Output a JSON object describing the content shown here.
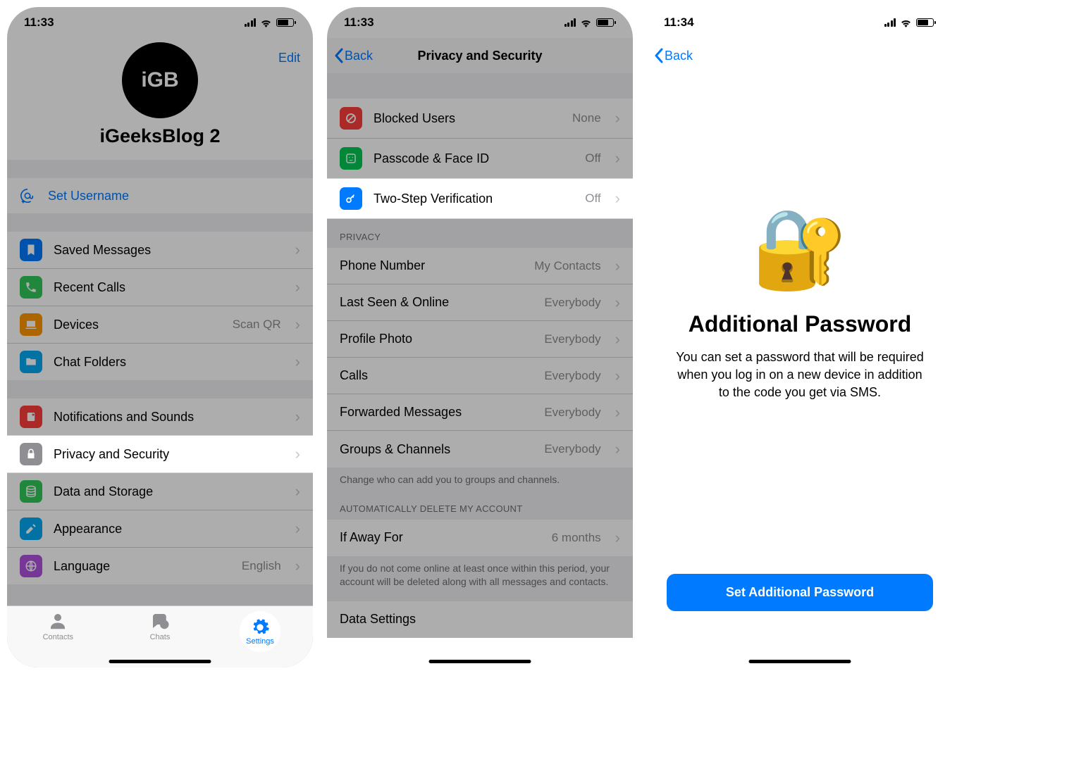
{
  "screen1": {
    "time": "11:33",
    "edit": "Edit",
    "avatar_label": "iGB",
    "profile_name": "iGeeksBlog 2",
    "set_username": "Set Username",
    "list_a": [
      {
        "label": "Saved Messages",
        "value": ""
      },
      {
        "label": "Recent Calls",
        "value": ""
      },
      {
        "label": "Devices",
        "value": "Scan QR"
      },
      {
        "label": "Chat Folders",
        "value": ""
      }
    ],
    "list_b": [
      {
        "label": "Notifications and Sounds",
        "value": ""
      },
      {
        "label": "Privacy and Security",
        "value": ""
      },
      {
        "label": "Data and Storage",
        "value": ""
      },
      {
        "label": "Appearance",
        "value": ""
      },
      {
        "label": "Language",
        "value": "English"
      }
    ],
    "tabs": {
      "contacts": "Contacts",
      "chats": "Chats",
      "settings": "Settings"
    }
  },
  "screen2": {
    "time": "11:33",
    "back": "Back",
    "title": "Privacy and Security",
    "security": [
      {
        "label": "Blocked Users",
        "value": "None"
      },
      {
        "label": "Passcode & Face ID",
        "value": "Off"
      },
      {
        "label": "Two-Step Verification",
        "value": "Off"
      }
    ],
    "privacy_header": "PRIVACY",
    "privacy": [
      {
        "label": "Phone Number",
        "value": "My Contacts"
      },
      {
        "label": "Last Seen & Online",
        "value": "Everybody"
      },
      {
        "label": "Profile Photo",
        "value": "Everybody"
      },
      {
        "label": "Calls",
        "value": "Everybody"
      },
      {
        "label": "Forwarded Messages",
        "value": "Everybody"
      },
      {
        "label": "Groups & Channels",
        "value": "Everybody"
      }
    ],
    "privacy_footer": "Change who can add you to groups and channels.",
    "auto_header": "AUTOMATICALLY DELETE MY ACCOUNT",
    "if_away": {
      "label": "If Away For",
      "value": "6 months"
    },
    "auto_footer": "If you do not come online at least once within this period, your account will be deleted along with all messages and contacts.",
    "data_settings": "Data Settings"
  },
  "screen3": {
    "time": "11:34",
    "back": "Back",
    "title": "Additional Password",
    "description": "You can set a password that will be required when you log in on a new device in addition to the code you get via SMS.",
    "button": "Set Additional Password"
  }
}
